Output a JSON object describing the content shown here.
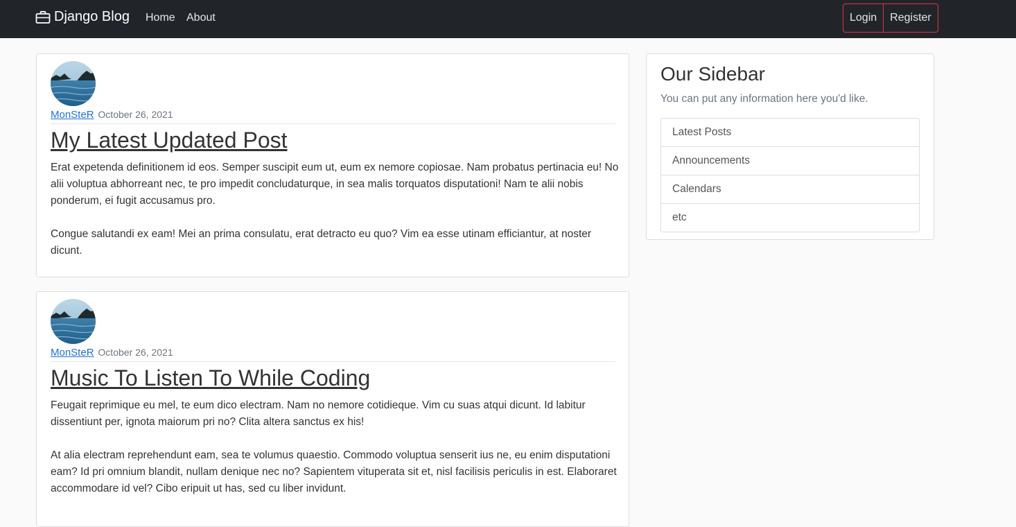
{
  "navbar": {
    "brand": "Django Blog",
    "links": [
      "Home",
      "About"
    ],
    "login": "Login",
    "register": "Register"
  },
  "posts": [
    {
      "author": "MonSteR",
      "date": "October 26, 2021",
      "title": "My Latest Updated Post",
      "paragraphs": [
        "Erat expetenda definitionem id eos. Semper suscipit eum ut, eum ex nemore copiosae. Nam probatus pertinacia eu! No alii voluptua abhorreant nec, te pro impedit concludaturque, in sea malis torquatos disputationi! Nam te alii nobis ponderum, ei fugit accusamus pro.",
        "Congue salutandi ex eam! Mei an prima consulatu, erat detracto eu quo? Vim ea esse utinam efficiantur, at noster dicunt."
      ]
    },
    {
      "author": "MonSteR",
      "date": "October 26, 2021",
      "title": "Music To Listen To While Coding",
      "paragraphs": [
        "Feugait reprimique eu mel, te eum dico electram. Nam no nemore cotidieque. Vim cu suas atqui dicunt. Id labitur dissentiunt per, ignota maiorum pri no? Clita altera sanctus ex his!",
        "At alia electram reprehendunt eam, sea te volumus quaestio. Commodo voluptua senserit ius ne, eu enim disputationi eam? Id pri omnium blandit, nullam denique nec no? Sapientem vituperata sit et, nisl facilisis periculis in est. Elaboraret accommodare id vel? Cibo eripuit ut has, sed cu liber invidunt."
      ]
    }
  ],
  "sidebar": {
    "title": "Our Sidebar",
    "text": "You can put any information here you'd like.",
    "items": [
      "Latest Posts",
      "Announcements",
      "Calendars",
      "etc"
    ]
  }
}
